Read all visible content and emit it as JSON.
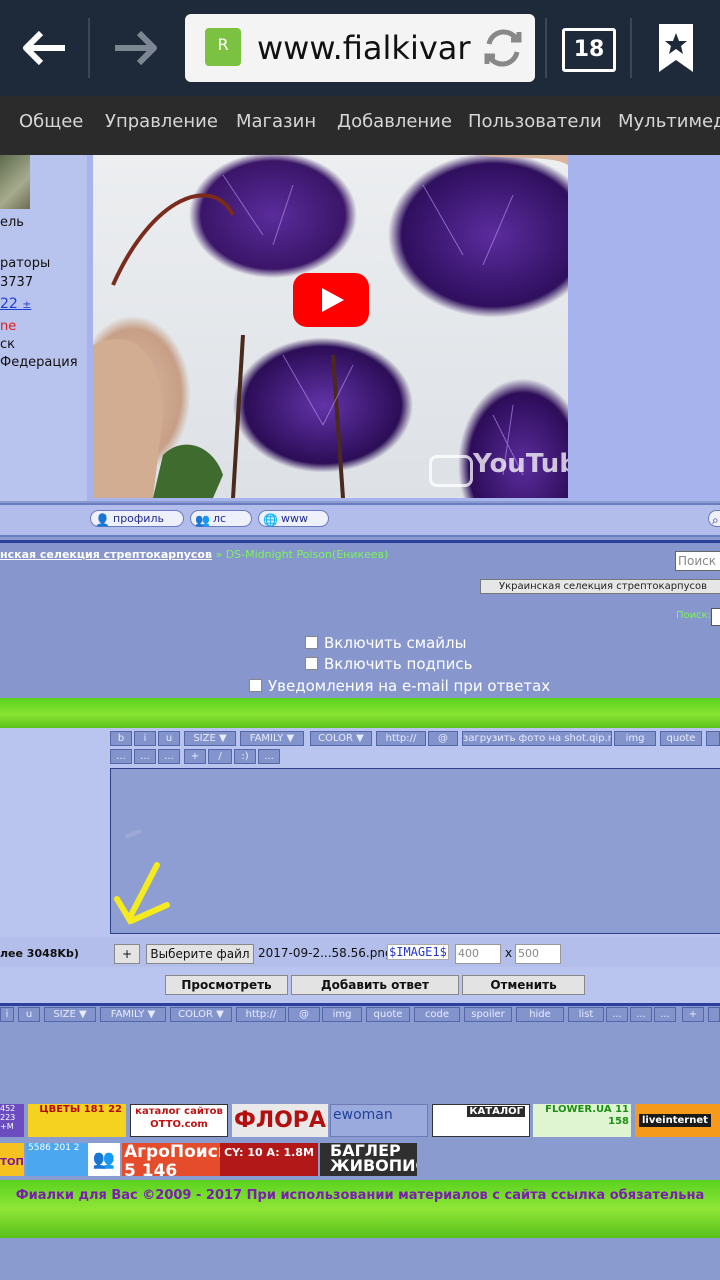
{
  "browser": {
    "url": "www.fialkivar",
    "site_icon": "R",
    "tabs_count": "18",
    "back_icon": "arrow-left-icon",
    "forward_icon": "arrow-right-icon",
    "reload_icon": "refresh-icon",
    "bookmark_icon": "bookmark-star-icon"
  },
  "site_menu": [
    "Общее",
    "Управление",
    "Магазин",
    "Добавление",
    "Пользователи",
    "Мультимеди"
  ],
  "profile": {
    "lines": [
      "ель",
      "раторы",
      "3737",
      "22",
      "ne",
      "ск",
      "Федерация"
    ]
  },
  "video": {
    "watermark": "YouTube"
  },
  "profile_actions": [
    "профиль",
    "лс",
    "www"
  ],
  "breadcrumb": {
    "part1": "нская селекция стрептокарпусов",
    "sep": " » ",
    "part2": "DS-Midnight Poison(Еникеев)"
  },
  "search_placeholder": "Поиск п",
  "forum_select": "Украинская селекция стрептокарпусов",
  "search_label": "Поиск:",
  "options": [
    "Включить смайлы",
    "Включить подпись",
    "Уведомления на e-mail при ответах"
  ],
  "toolbar_row1": [
    "b",
    "i",
    "u",
    "SIZE",
    "FAMILY",
    "COLOR",
    "http://",
    "@",
    "загрузить фото на shot.qip.ru",
    "img",
    "quote"
  ],
  "toolbar_row2": [
    "...",
    "...",
    "...",
    "+",
    "/",
    ":)",
    "..."
  ],
  "upload": {
    "limit": "лее 3048Kb)",
    "add": "+",
    "choose": "Выберите файл",
    "filename": "2017-09-2...58.56.png",
    "image_tag": "$IMAGE1$",
    "width": "400",
    "x": "x",
    "height": "500"
  },
  "actions": [
    "Просмотреть",
    "Добавить ответ",
    "Отменить"
  ],
  "toolbar_row3": [
    "i",
    "u",
    "SIZE",
    "FAMILY",
    "COLOR",
    "http://",
    "@",
    "img",
    "quote",
    "code",
    "spoiler",
    "hide",
    "list",
    "...",
    "...",
    "...",
    "+"
  ],
  "banners_row1": [
    {
      "label": "452 223 +M",
      "bg": "#6b4dbf"
    },
    {
      "label": "ЦВЕТЫ 181 22",
      "bg": "#f5d21f"
    },
    {
      "label": "каталог сайтов OTTO.com",
      "bg": "#ffffff"
    },
    {
      "label": "ФЛОРА",
      "bg": "#e9e9e9"
    },
    {
      "label": "ewoman",
      "bg": "#9aaadc"
    },
    {
      "label": "КАТАЛОГ",
      "bg": "#ffffff"
    },
    {
      "label": "FLOWER.UA 11 158",
      "bg": "#dff5d2"
    },
    {
      "label": "liveinternet",
      "bg": "#f59a1b"
    }
  ],
  "banners_row2": [
    {
      "label": "ТОП",
      "bg": "#f5c21f"
    },
    {
      "label": "5586 201 2",
      "bg": "#4aa7f0"
    },
    {
      "label": "",
      "bg": "#ffffff"
    },
    {
      "label": "АгроПоиск 5 146",
      "bg": "#e44c2c"
    },
    {
      "label": "CY: 10 A: 1.8M",
      "bg": "#b31818"
    },
    {
      "label": "БАГЛЕР ЖИВОПИСЬ",
      "bg": "#2f2f2f"
    }
  ],
  "footer": "Фиалки для Вас ©2009 - 2017 При использовании материалов с сайта ссылка обязательна"
}
